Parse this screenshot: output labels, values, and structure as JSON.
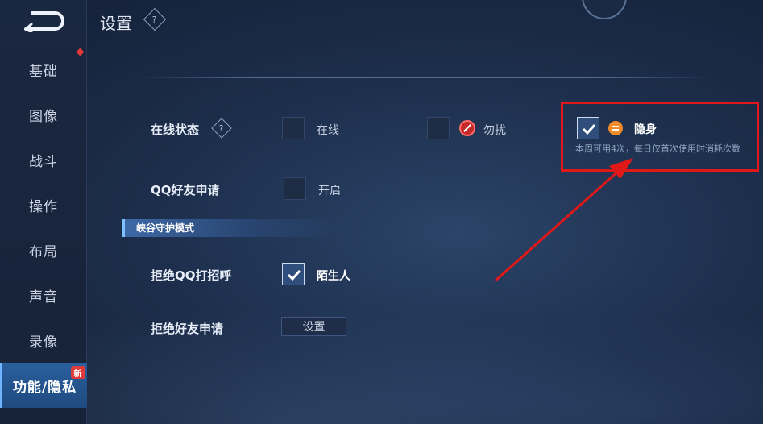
{
  "header": {
    "title": "设置",
    "help_glyph": "?"
  },
  "sidebar": {
    "back_icon": "back-arrow-icon",
    "items": [
      {
        "label": "基础",
        "dot": true
      },
      {
        "label": "图像"
      },
      {
        "label": "战斗"
      },
      {
        "label": "操作"
      },
      {
        "label": "布局"
      },
      {
        "label": "声音"
      },
      {
        "label": "录像"
      },
      {
        "label": "功能/隐私",
        "active": true,
        "badge": "新"
      }
    ]
  },
  "online_status": {
    "label": "在线状态",
    "help_glyph": "?",
    "options": [
      {
        "label": "在线",
        "checked": false
      },
      {
        "label": "勿扰",
        "checked": false,
        "icon": "no-entry-icon"
      },
      {
        "label": "隐身",
        "checked": true,
        "icon": "invisible-icon"
      }
    ],
    "hint": "本周可用4次，每日仅首次使用时消耗次数"
  },
  "qq_friend_request": {
    "label": "QQ好友申请",
    "option": "开启",
    "checked": false
  },
  "section": {
    "title": "峡谷守护模式"
  },
  "reject_qq_greeting": {
    "label": "拒绝QQ打招呼",
    "option": "陌生人",
    "checked": true
  },
  "reject_friend_request": {
    "label": "拒绝好友申请",
    "button": "设置"
  },
  "annotation": {
    "color": "#e01818"
  }
}
